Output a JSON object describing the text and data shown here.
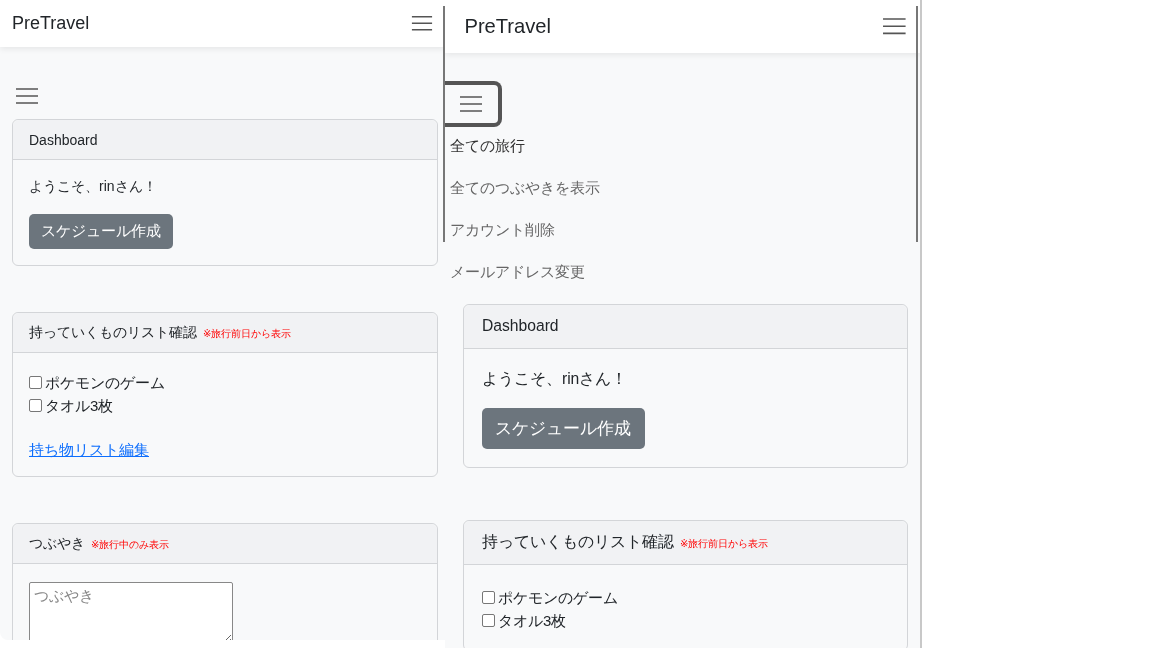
{
  "panels": [
    {
      "brand": "PreTravel",
      "sidebar_toggle": {
        "expanded": false
      },
      "cards": [
        {
          "kind": "dashboard",
          "title": "Dashboard",
          "greeting": "ようこそ、rinさん！",
          "button": "スケジュール作成"
        },
        {
          "kind": "checklist",
          "title": "持っていくものリスト確認",
          "note": "※旅行前日から表示",
          "items": [
            {
              "label": "ポケモンのゲーム",
              "checked": false
            },
            {
              "label": "タオル3枚",
              "checked": false
            }
          ],
          "link": "持ち物リスト編集"
        },
        {
          "kind": "post",
          "title": "つぶやき",
          "note": "※旅行中のみ表示",
          "placeholder": "つぶやき"
        }
      ]
    },
    {
      "brand": "PreTravel",
      "sidebar_toggle": {
        "expanded": true
      },
      "nav_links": [
        "全ての旅行",
        "全てのつぶやきを表示",
        "アカウント削除",
        "メールアドレス変更"
      ],
      "cards": [
        {
          "kind": "dashboard",
          "title": "Dashboard",
          "greeting": "ようこそ、rinさん！",
          "button": "スケジュール作成"
        },
        {
          "kind": "checklist",
          "title": "持っていくものリスト確認",
          "note": "※旅行前日から表示",
          "items": [
            {
              "label": "ポケモンのゲーム",
              "checked": false
            },
            {
              "label": "タオル3枚",
              "checked": false
            }
          ]
        }
      ]
    }
  ]
}
